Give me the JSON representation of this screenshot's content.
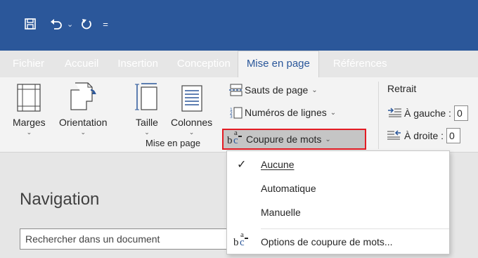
{
  "qat": {
    "save_icon": "save-icon",
    "undo_icon": "undo-icon",
    "undo_caret": "⌄",
    "redo_icon": "redo-icon",
    "customize_caret": "="
  },
  "tabs": [
    {
      "label": "Fichier"
    },
    {
      "label": "Accueil"
    },
    {
      "label": "Insertion"
    },
    {
      "label": "Conception"
    },
    {
      "label": "Mise en page"
    },
    {
      "label": "Références"
    }
  ],
  "ribbon": {
    "page_setup": {
      "margins": "Marges",
      "orientation": "Orientation",
      "size": "Taille",
      "columns": "Colonnes",
      "group_label": "Mise en page"
    },
    "breaks": "Sauts de page",
    "line_numbers": "Numéros de lignes",
    "hyphenation": "Coupure de mots",
    "indent": {
      "title": "Retrait",
      "left_label": "À gauche :",
      "left_value": "0",
      "right_label": "À droite :",
      "right_value": "0"
    }
  },
  "hyph_icon_text": {
    "b": "b",
    "c": "c",
    "a": "a"
  },
  "menu": {
    "items": [
      {
        "label": "Aucune",
        "checked": true
      },
      {
        "label": "Automatique"
      },
      {
        "label": "Manuelle"
      },
      {
        "label": "Options de coupure de mots..."
      }
    ],
    "check_glyph": "✓"
  },
  "navigation": {
    "title": "Navigation",
    "search_placeholder": "Rechercher dans un document"
  },
  "colors": {
    "accent": "#2b579a",
    "highlight_border": "#e31b23"
  }
}
